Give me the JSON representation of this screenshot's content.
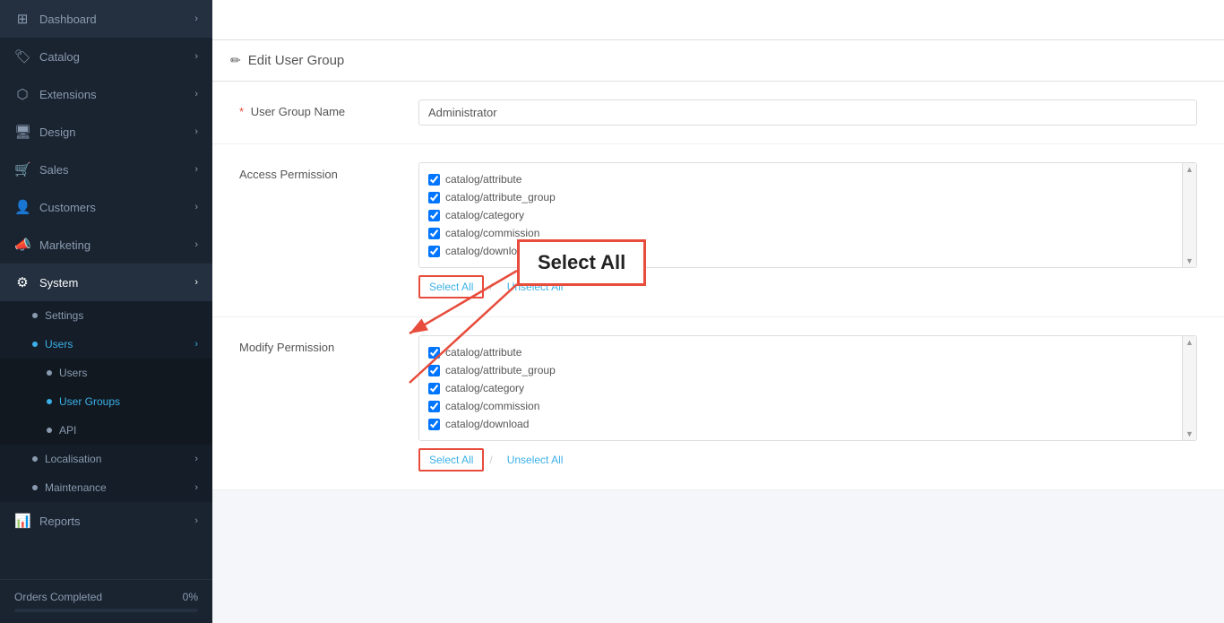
{
  "sidebar": {
    "items": [
      {
        "id": "dashboard",
        "label": "Dashboard",
        "icon": "⊞",
        "hasChevron": true,
        "active": false
      },
      {
        "id": "catalog",
        "label": "Catalog",
        "icon": "🏷",
        "hasChevron": true,
        "active": false
      },
      {
        "id": "extensions",
        "label": "Extensions",
        "icon": "🧩",
        "hasChevron": true,
        "active": false
      },
      {
        "id": "design",
        "label": "Design",
        "icon": "🖥",
        "hasChevron": true,
        "active": false
      },
      {
        "id": "sales",
        "label": "Sales",
        "icon": "🛒",
        "hasChevron": true,
        "active": false
      },
      {
        "id": "customers",
        "label": "Customers",
        "icon": "👤",
        "hasChevron": true,
        "active": false
      },
      {
        "id": "marketing",
        "label": "Marketing",
        "icon": "📣",
        "hasChevron": true,
        "active": false
      },
      {
        "id": "system",
        "label": "System",
        "icon": "⚙",
        "hasChevron": true,
        "active": true
      }
    ],
    "sub_settings": {
      "label": "Settings",
      "active": false
    },
    "sub_users": {
      "label": "Users",
      "active": false
    },
    "sub_users_users": {
      "label": "Users",
      "active": false
    },
    "sub_users_usergroups": {
      "label": "User Groups",
      "active": true
    },
    "sub_users_api": {
      "label": "API",
      "active": false
    },
    "sub_localisation": {
      "label": "Localisation",
      "active": false
    },
    "sub_maintenance": {
      "label": "Maintenance",
      "active": false
    },
    "sub_reports": {
      "label": "Reports",
      "active": false
    },
    "orders_label": "Orders Completed",
    "orders_percent": "0%"
  },
  "page": {
    "title": "Edit User Group",
    "user_group_name_label": "User Group Name",
    "user_group_name_required": "*",
    "user_group_name_value": "Administrator",
    "access_permission_label": "Access Permission",
    "modify_permission_label": "Modify Permission"
  },
  "access_permissions": [
    "catalog/attribute",
    "catalog/attribute_group",
    "catalog/category",
    "catalog/commission",
    "catalog/download"
  ],
  "modify_permissions": [
    "catalog/attribute",
    "catalog/attribute_group",
    "catalog/category",
    "catalog/commission",
    "catalog/download"
  ],
  "buttons": {
    "select_all": "Select All",
    "unselect_all": "Unselect All",
    "select_all_annotation": "Select All"
  }
}
